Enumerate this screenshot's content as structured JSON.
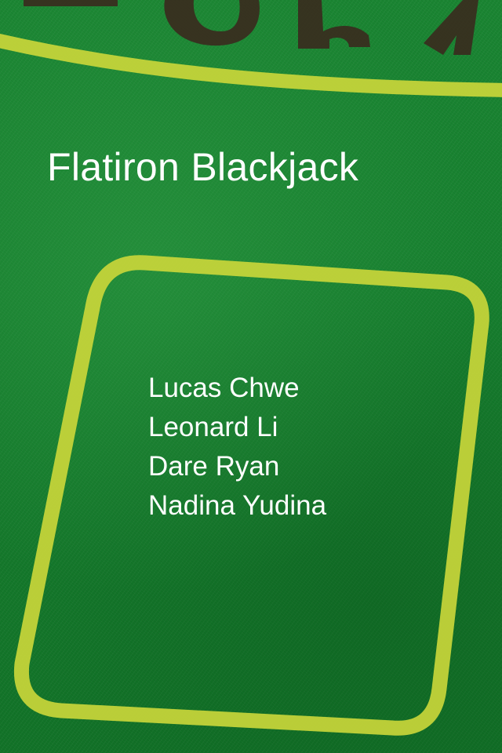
{
  "screen": {
    "title": "Flatiron Blackjack",
    "players": [
      "Lucas Chwe",
      "Leonard Li",
      "Dare Ryan",
      "Nadina Yudina"
    ]
  },
  "colors": {
    "felt": "#157a2c",
    "line": "#c9d63a",
    "print": "#3a2a1e",
    "text": "#ffffff"
  }
}
